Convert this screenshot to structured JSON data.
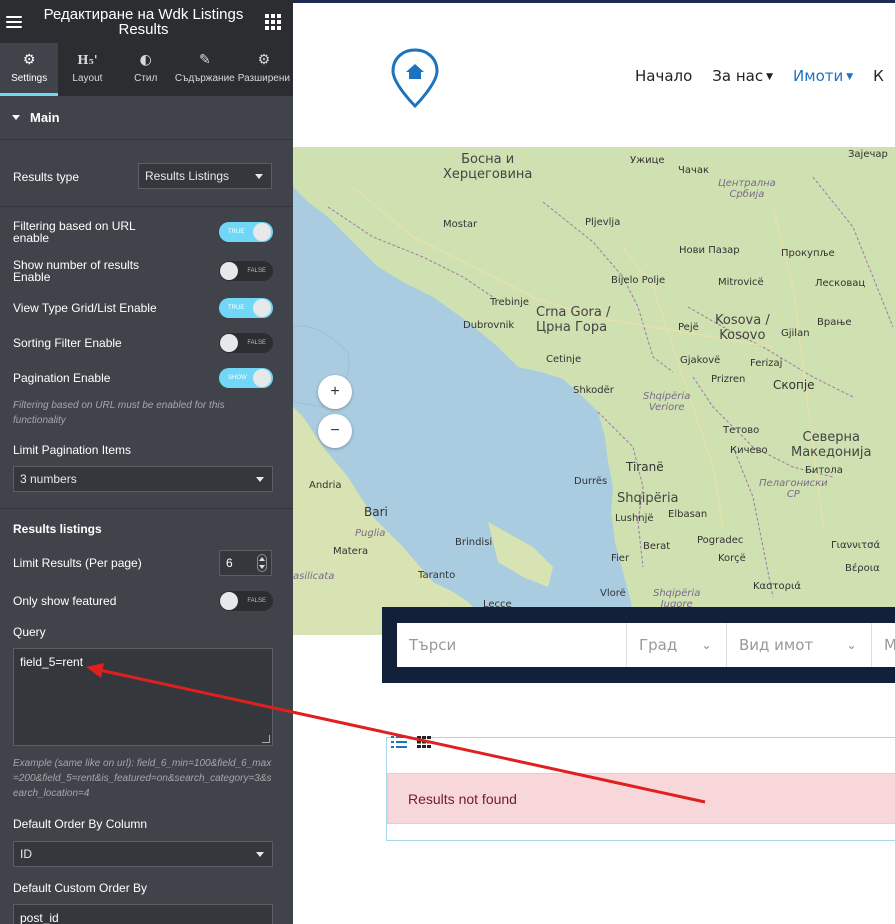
{
  "panel": {
    "title": "Редактиране на Wdk Listings Results",
    "tabs": [
      {
        "label": "Settings",
        "icon": "gears-icon"
      },
      {
        "label": "Layout",
        "icon": "heading-icon"
      },
      {
        "label": "Стил",
        "icon": "contrast-icon"
      },
      {
        "label": "Съдържание",
        "icon": "pencil-icon"
      },
      {
        "label": "Разширени",
        "icon": "gear-icon"
      }
    ],
    "section": "Main",
    "results_type": {
      "label": "Results type",
      "value": "Results Listings"
    },
    "toggles": {
      "filtering_url": {
        "label": "Filtering based on URL enable",
        "state": "TRUE",
        "on": true
      },
      "show_number": {
        "label": "Show number of results Enable",
        "state": "FALSE",
        "on": false
      },
      "view_type": {
        "label": "View Type Grid/List Enable",
        "state": "TRUE",
        "on": true
      },
      "sorting": {
        "label": "Sorting Filter Enable",
        "state": "FALSE",
        "on": false
      },
      "pagination": {
        "label": "Pagination Enable",
        "state": "SHOW",
        "on": true
      }
    },
    "pagination_note": "Filtering based on URL must be enabled for this functionality",
    "limit_pagination": {
      "label": "Limit Pagination Items",
      "value": "3 numbers"
    },
    "results_listings": "Results listings",
    "limit_results": {
      "label": "Limit Results (Per page)",
      "value": "6"
    },
    "only_featured": {
      "label": "Only show featured",
      "state": "FALSE",
      "on": false
    },
    "query": {
      "label": "Query",
      "value": "field_5=rent"
    },
    "query_example": "Example (same like on url): field_6_min=100&field_6_max=200&field_5=rent&is_featured=on&search_category=3&search_location=4",
    "order_by": {
      "label": "Default Order By Column",
      "value": "ID"
    },
    "custom_order": {
      "label": "Default Custom Order By",
      "value": "post_id"
    },
    "collapse_icon": "‹"
  },
  "site": {
    "nav": [
      "Начало",
      "За нас",
      "Имоти",
      "К"
    ],
    "map_labels": {
      "bosna": "Босна и\nХерцеговина",
      "uzice": "Ужице",
      "cacak": "Чачак",
      "zajecar": "Зајечар",
      "centralna": "Централна\nСрбија",
      "mostar": "Mostar",
      "pljevlja": "Pljevlja",
      "novi_pazar": "Нови Пазар",
      "prokuplje": "Прокупље",
      "bijelo_polje": "Bijelo Polje",
      "mitrovice": "Mitrovicë",
      "leskovac": "Лесковац",
      "trebinje": "Trebinje",
      "dubrovnik": "Dubrovnik",
      "crna_gora": "Crna Gora /\nЦрна Гора",
      "peje": "Pejë",
      "kosova": "Kosova /\nKosovo",
      "gjilan": "Gjilan",
      "vranje": "Врање",
      "cetinje": "Cetinje",
      "gjakove": "Gjakovë",
      "ferizaj": "Ferizaj",
      "prizren": "Prizren",
      "skopje": "Скопје",
      "shkoder": "Shkodër",
      "shqiperia_veriore": "Shqipëria\nVeriore",
      "tetovo": "Тетово",
      "severna": "Северна\nМакедонија",
      "kicevo": "Кичево",
      "tirane": "Tiranë",
      "durres": "Durrës",
      "shqiperia": "Shqipëria",
      "bitola": "Битола",
      "pelagonisko": "Пелагониски\nСР",
      "andria": "Andria",
      "bari": "Bari",
      "elbasan": "Elbasan",
      "lushnje": "Lushnjë",
      "puglia": "Puglia",
      "pogradec": "Pogradec",
      "matera": "Matera",
      "berat": "Berat",
      "korce": "Korçë",
      "fier": "Fier",
      "brindisi": "Brindisi",
      "giannitsa": "Γιαννιτσά",
      "taranto": "Taranto",
      "basilicata": "asilicata",
      "vlore": "Vlorë",
      "shqiperia_jugore": "Shqipëria\nJugore",
      "kastoria": "Καστοριά",
      "veroia": "Βέροια",
      "lecce": "Lecce"
    },
    "zoom_in": "+",
    "zoom_out": "−",
    "search": {
      "placeholder": "Търси",
      "city": "Град",
      "type": "Вид имот",
      "more": "М"
    },
    "no_results": "Results not found"
  },
  "colors": {
    "panel_bg": "#404349",
    "panel_header": "#2b2d31",
    "accent": "#71d7f7",
    "nav_active": "#1e73be",
    "searchbar": "#12203a",
    "alert_bg": "#f8d7da",
    "alert_text": "#721c24",
    "arrow": "#e0201f"
  }
}
